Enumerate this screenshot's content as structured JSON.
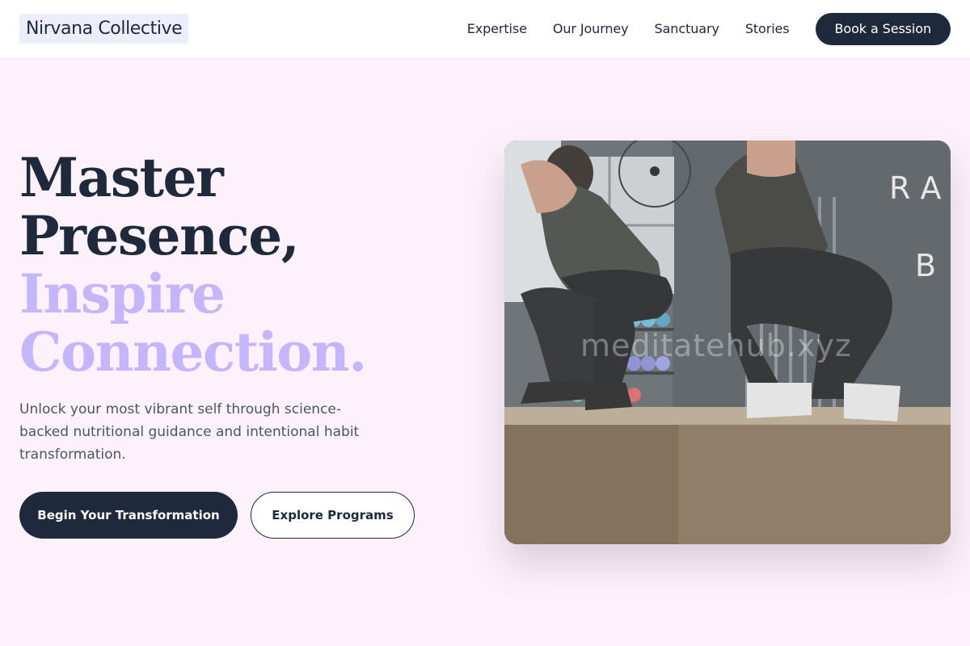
{
  "header": {
    "brand": "Nirvana Collective",
    "nav": [
      "Expertise",
      "Our Journey",
      "Sanctuary",
      "Stories"
    ],
    "cta_label": "Book a Session"
  },
  "hero": {
    "headline_dark_1": "Master",
    "headline_dark_2": "Presence,",
    "headline_light_1": "Inspire",
    "headline_light_2": "Connection.",
    "subtext": "Unlock your most vibrant self through science-backed nutritional guidance and intentional habit transformation.",
    "primary_button": "Begin Your Transformation",
    "secondary_button": "Explore Programs",
    "image_watermark": "meditatehub.xyz",
    "wall_letters": "RA TB"
  },
  "colors": {
    "dark": "#1e293b",
    "accent": "#c4b5fd",
    "background": "#fdf2fb"
  }
}
